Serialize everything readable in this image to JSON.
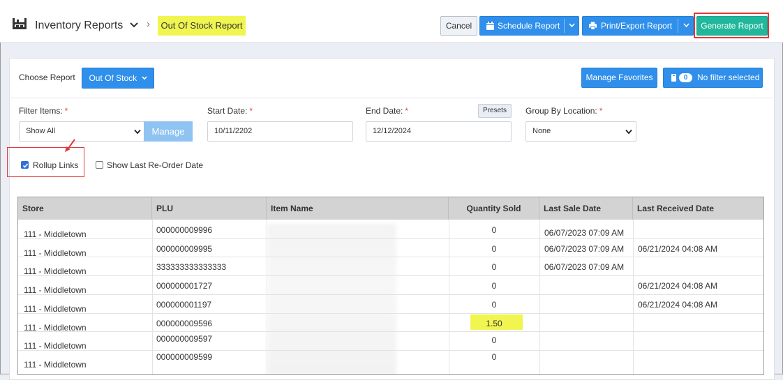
{
  "header": {
    "title": "Inventory Reports",
    "breadcrumb": "Out Of Stock Report",
    "cancel_label": "Cancel",
    "schedule_label": "Schedule Report",
    "print_label": "Print/Export Report",
    "generate_label": "Generate Report"
  },
  "toolbar": {
    "choose_report_label": "Choose Report",
    "report_type": "Out Of Stock",
    "manage_favorites_label": "Manage Favorites",
    "filter_count": "0",
    "filter_text": "No filter selected"
  },
  "filters": {
    "filter_items_label": "Filter Items:",
    "filter_items_value": "Show All",
    "manage_label": "Manage",
    "start_date_label": "Start Date:",
    "start_date_value": "10/11/2202",
    "end_date_label": "End Date:",
    "end_date_value": "12/12/2024",
    "presets_label": "Presets",
    "group_by_label": "Group By Location:",
    "group_by_value": "None",
    "required_mark": "*",
    "rollup_label": "Rollup Links",
    "rollup_checked": true,
    "show_last_reorder_label": "Show Last Re-Order Date",
    "show_last_reorder_checked": false
  },
  "table": {
    "columns": [
      "Store",
      "PLU",
      "Item Name",
      "Quantity Sold",
      "Last Sale Date",
      "Last Received Date"
    ],
    "rows": [
      {
        "store": "111 - Middletown",
        "plu": "000000009996",
        "qty": "0",
        "last_sale": "06/07/2023 07:09 AM",
        "last_received": ""
      },
      {
        "store": "111 - Middletown",
        "plu": "000000009995",
        "qty": "0",
        "last_sale": "06/07/2023 07:09 AM",
        "last_received": "06/21/2024 04:08 AM"
      },
      {
        "store": "111 - Middletown",
        "plu": "333333333333333",
        "qty": "0",
        "last_sale": "06/07/2023 07:09 AM",
        "last_received": ""
      },
      {
        "store": "111 - Middletown",
        "plu": "000000001727",
        "qty": "0",
        "last_sale": "",
        "last_received": "06/21/2024 04:08 AM"
      },
      {
        "store": "111 - Middletown",
        "plu": "000000001197",
        "qty": "0",
        "last_sale": "",
        "last_received": "06/21/2024 04:08 AM"
      },
      {
        "store": "111 - Middletown",
        "plu": "000000009596",
        "qty": "1.50",
        "last_sale": "",
        "last_received": ""
      },
      {
        "store": "111 - Middletown",
        "plu": "000000009597",
        "qty": "0",
        "last_sale": "",
        "last_received": ""
      },
      {
        "store": "111 - Middletown",
        "plu": "000000009599",
        "qty": "0",
        "last_sale": "",
        "last_received": ""
      }
    ]
  },
  "colors": {
    "primary_blue": "#2f8fea",
    "generate_teal": "#20b79c",
    "highlight_yellow": "#f1f550",
    "annotation_red": "#e23a3a"
  }
}
